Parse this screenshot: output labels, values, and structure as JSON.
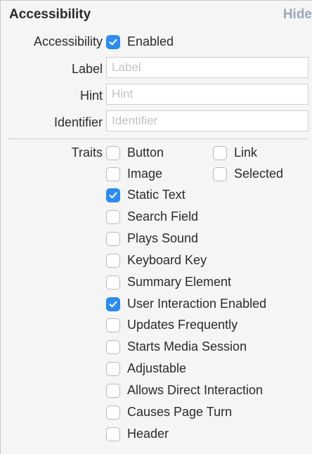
{
  "section": {
    "title": "Accessibility",
    "hide_label": "Hide"
  },
  "accessibility": {
    "label": "Accessibility",
    "enabled_label": "Enabled",
    "enabled": true
  },
  "fields": {
    "label": {
      "label": "Label",
      "placeholder": "Label",
      "value": ""
    },
    "hint": {
      "label": "Hint",
      "placeholder": "Hint",
      "value": ""
    },
    "identifier": {
      "label": "Identifier",
      "placeholder": "Identifier",
      "value": ""
    }
  },
  "traits": {
    "label": "Traits",
    "items": [
      {
        "label": "Button",
        "checked": false
      },
      {
        "label": "Link",
        "checked": false
      },
      {
        "label": "Image",
        "checked": false
      },
      {
        "label": "Selected",
        "checked": false
      },
      {
        "label": "Static Text",
        "checked": true
      },
      {
        "label": "Search Field",
        "checked": false
      },
      {
        "label": "Plays Sound",
        "checked": false
      },
      {
        "label": "Keyboard Key",
        "checked": false
      },
      {
        "label": "Summary Element",
        "checked": false
      },
      {
        "label": "User Interaction Enabled",
        "checked": true
      },
      {
        "label": "Updates Frequently",
        "checked": false
      },
      {
        "label": "Starts Media Session",
        "checked": false
      },
      {
        "label": "Adjustable",
        "checked": false
      },
      {
        "label": "Allows Direct Interaction",
        "checked": false
      },
      {
        "label": "Causes Page Turn",
        "checked": false
      },
      {
        "label": "Header",
        "checked": false
      }
    ]
  },
  "colors": {
    "check_accent": "#2d8cf0",
    "hide_link": "#9aa9bd"
  }
}
